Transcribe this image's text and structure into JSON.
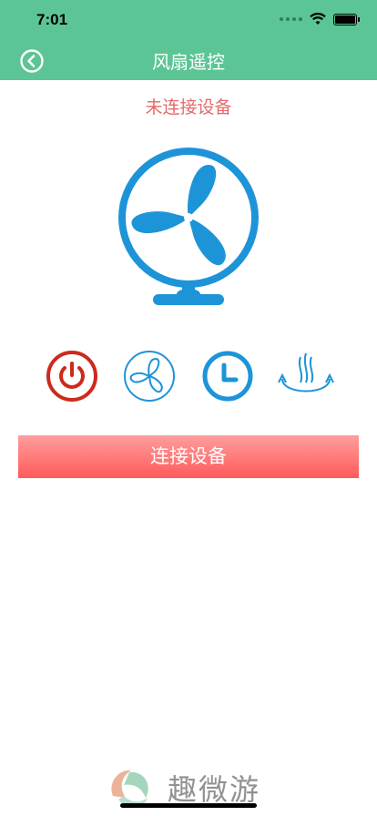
{
  "status_bar": {
    "time": "7:01"
  },
  "header": {
    "title": "风扇遥控"
  },
  "connection": {
    "status_text": "未连接设备"
  },
  "controls": [
    "power",
    "wind-speed",
    "timer",
    "swing"
  ],
  "actions": {
    "connect_label": "连接设备"
  },
  "colors": {
    "header": "#5cc595",
    "fan_blue": "#1e94d8",
    "power_red": "#cc2a1c",
    "status_red": "#e46a6a",
    "button_top": "#ff9e9e",
    "button_bottom": "#ff5a5a"
  },
  "watermark": {
    "text": "趣微游"
  }
}
